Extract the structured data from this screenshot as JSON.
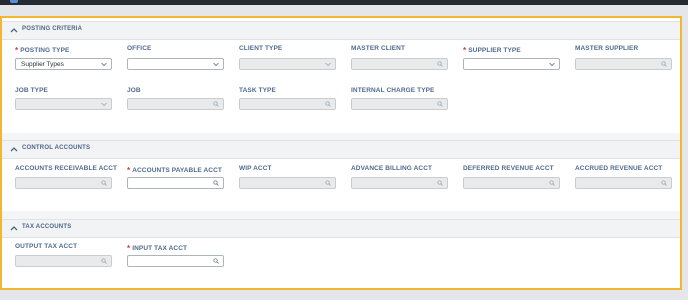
{
  "sections": {
    "posting": {
      "title": "POSTING CRITERIA",
      "fields": {
        "posting_type": {
          "label": "POSTING TYPE",
          "value": "Supplier Types"
        },
        "office": {
          "label": "OFFICE",
          "value": ""
        },
        "client_type": {
          "label": "CLIENT TYPE",
          "value": ""
        },
        "master_client": {
          "label": "MASTER CLIENT",
          "value": ""
        },
        "supplier_type": {
          "label": "SUPPLIER TYPE",
          "value": ""
        },
        "master_supplier": {
          "label": "MASTER SUPPLIER",
          "value": ""
        },
        "job_type": {
          "label": "JOB TYPE",
          "value": ""
        },
        "job": {
          "label": "JOB",
          "value": ""
        },
        "task_type": {
          "label": "TASK TYPE",
          "value": ""
        },
        "internal_charge_type": {
          "label": "INTERNAL CHARGE TYPE",
          "value": ""
        }
      }
    },
    "control": {
      "title": "CONTROL ACCOUNTS",
      "fields": {
        "ar_acct": {
          "label": "ACCOUNTS RECEIVABLE ACCT",
          "value": ""
        },
        "ap_acct": {
          "label": "ACCOUNTS PAYABLE ACCT",
          "value": ""
        },
        "wip_acct": {
          "label": "WIP ACCT",
          "value": ""
        },
        "advance_billing_acct": {
          "label": "ADVANCE BILLING ACCT",
          "value": ""
        },
        "deferred_revenue_acct": {
          "label": "DEFERRED REVENUE ACCT",
          "value": ""
        },
        "accrued_revenue_acct": {
          "label": "ACCRUED REVENUE ACCT",
          "value": ""
        }
      }
    },
    "tax": {
      "title": "TAX ACCOUNTS",
      "fields": {
        "output_tax_acct": {
          "label": "OUTPUT TAX ACCT",
          "value": ""
        },
        "input_tax_acct": {
          "label": "INPUT TAX ACCT",
          "value": ""
        }
      }
    }
  },
  "required_marker": "*",
  "colors": {
    "focus_border": "#f2b631",
    "label": "#4f6a8e",
    "required": "#d63b2f",
    "disabled_fill": "#e9eaec"
  },
  "icons": {
    "section_toggle": "chevron-up-icon",
    "dropdown": "chevron-down-icon",
    "lookup": "search-icon"
  }
}
